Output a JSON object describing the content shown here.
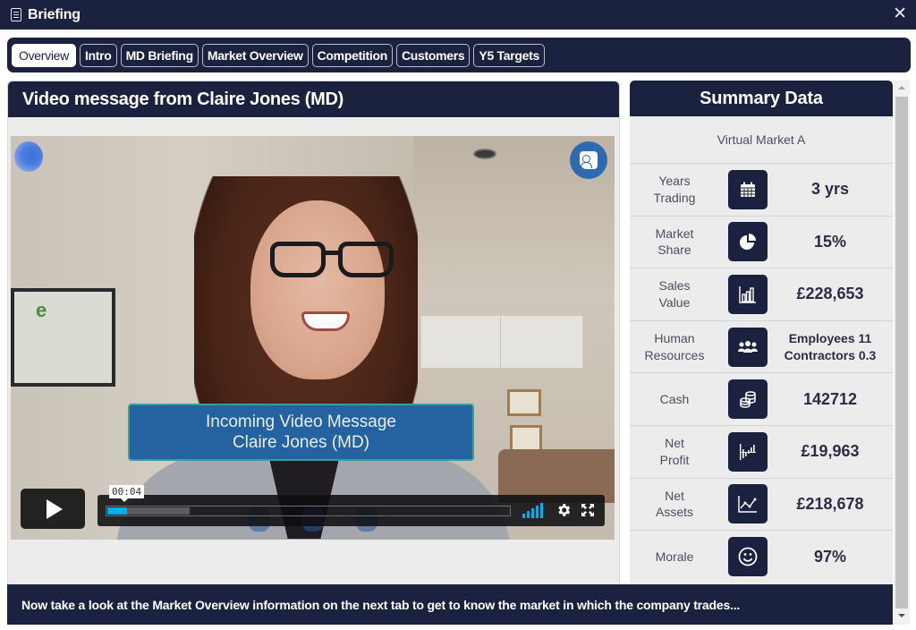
{
  "window": {
    "title": "Briefing",
    "title_icon": "clipboard-icon",
    "close_icon": "close-icon",
    "close_glyph": "✕"
  },
  "tabs": [
    {
      "label": "Overview",
      "active": true
    },
    {
      "label": "Intro",
      "active": false
    },
    {
      "label": "MD Briefing",
      "active": false
    },
    {
      "label": "Market Overview",
      "active": false
    },
    {
      "label": "Competition",
      "active": false
    },
    {
      "label": "Customers",
      "active": false
    },
    {
      "label": "Y5 Targets",
      "active": false
    }
  ],
  "main": {
    "title": "Video message from Claire Jones (MD)",
    "video": {
      "overlay_line1": "Incoming Video Message",
      "overlay_line2": "Claire Jones (MD)",
      "current_time": "00:04",
      "played_fraction": 0.05,
      "loaded_fraction": 0.205,
      "volume_level": 1.0,
      "accent_color": "#00adef"
    },
    "footer_text": "Now take a look at the Market Overview information on the next tab to get to know the market in which the company trades..."
  },
  "summary": {
    "title": "Summary Data",
    "market": "Virtual Market A",
    "rows": [
      {
        "label_line1": "Years",
        "label_line2": "Trading",
        "icon": "calendar-icon",
        "value": "3 yrs"
      },
      {
        "label_line1": "Market",
        "label_line2": "Share",
        "icon": "pie-chart-icon",
        "value": "15%"
      },
      {
        "label_line1": "Sales",
        "label_line2": "Value",
        "icon": "bar-chart-icon",
        "value": "£228,653"
      },
      {
        "label_line1": "Human",
        "label_line2": "Resources",
        "icon": "people-icon",
        "value_line1": "Employees 11",
        "value_line2": "Contractors 0.3"
      },
      {
        "label_line1": "Cash",
        "label_line2": "",
        "icon": "coins-icon",
        "value": "142712"
      },
      {
        "label_line1": "Net",
        "label_line2": "Profit",
        "icon": "waterfall-chart-icon",
        "value": "£19,963"
      },
      {
        "label_line1": "Net",
        "label_line2": "Assets",
        "icon": "line-chart-icon",
        "value": "£218,678"
      },
      {
        "label_line1": "Morale",
        "label_line2": "",
        "icon": "smiley-icon",
        "value": "97%"
      }
    ]
  },
  "colors": {
    "navy": "#1b2240",
    "panel_bg": "#ececec",
    "overlay_blue": "#2462a0"
  }
}
